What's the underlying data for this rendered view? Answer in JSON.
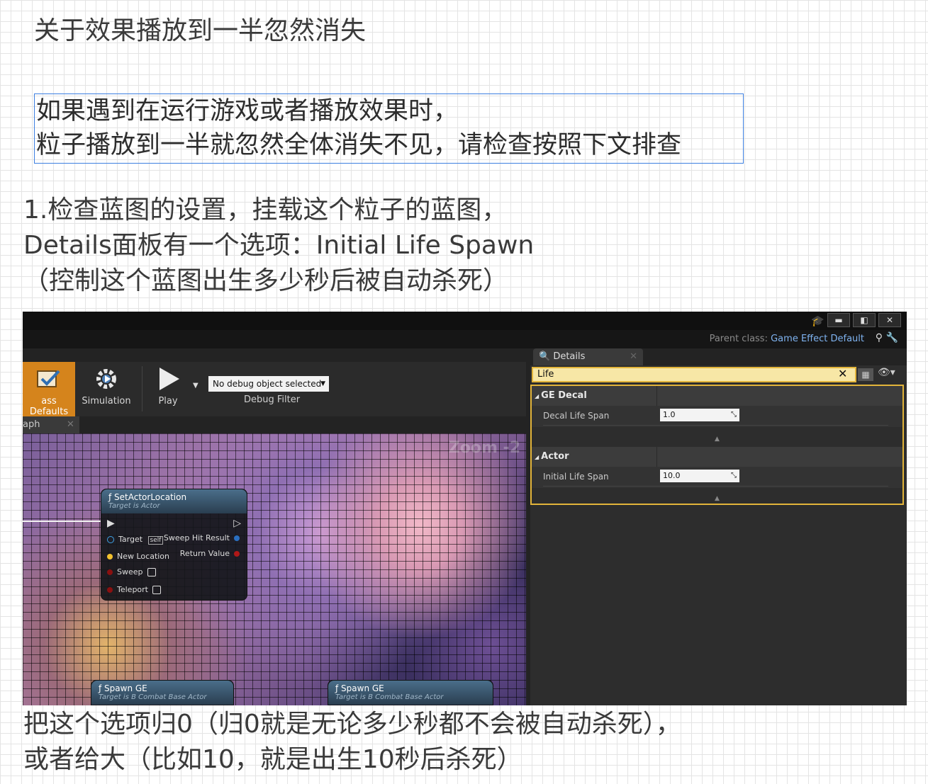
{
  "doc": {
    "title": "关于效果播放到一半忽然消失",
    "callout_lines": [
      "如果遇到在运行游戏或者播放效果时，",
      "粒子播放到一半就忽然全体消失不见，请检查按照下文排查"
    ],
    "step_lines": [
      "1.检查蓝图的设置，挂载这个粒子的蓝图，",
      "Details面板有一个选项：Initial Life Spawn",
      "（控制这个蓝图出生多少秒后被自动杀死）"
    ],
    "bottom_lines": [
      "把这个选项归0（归0就是无论多少秒都不会被自动杀死），",
      "或者给大（比如10，就是出生10秒后杀死）"
    ]
  },
  "editor": {
    "window_buttons": [
      "▬",
      "◧",
      "✕"
    ],
    "parent_class_label": "Parent class:",
    "parent_class_value": "Game Effect Default",
    "toolbar": {
      "class_defaults": "ass Defaults",
      "simulation": "Simulation",
      "play": "Play",
      "debug_select": "No debug object selected",
      "debug_filter": "Debug Filter"
    },
    "graph_tab": "aph",
    "zoom": "Zoom -2",
    "node_main": {
      "title": "SetActorLocation",
      "subtitle": "Target is Actor",
      "pins_in": [
        "Target",
        "New Location",
        "Sweep",
        "Teleport"
      ],
      "target_default": "self",
      "pins_out": [
        "Sweep Hit Result",
        "Return Value"
      ]
    },
    "node_spawn_1": {
      "title": "Spawn GE",
      "subtitle": "Target is B Combat Base Actor"
    },
    "node_spawn_2": {
      "title": "Spawn GE",
      "subtitle": "Target is B Combat Base Actor"
    },
    "details": {
      "tab": "Details",
      "search_value": "Life",
      "categories": [
        {
          "name": "GE Decal",
          "prop": "Decal Life Span",
          "value": "1.0"
        },
        {
          "name": "Actor",
          "prop": "Initial Life Span",
          "value": "10.0"
        }
      ]
    }
  }
}
